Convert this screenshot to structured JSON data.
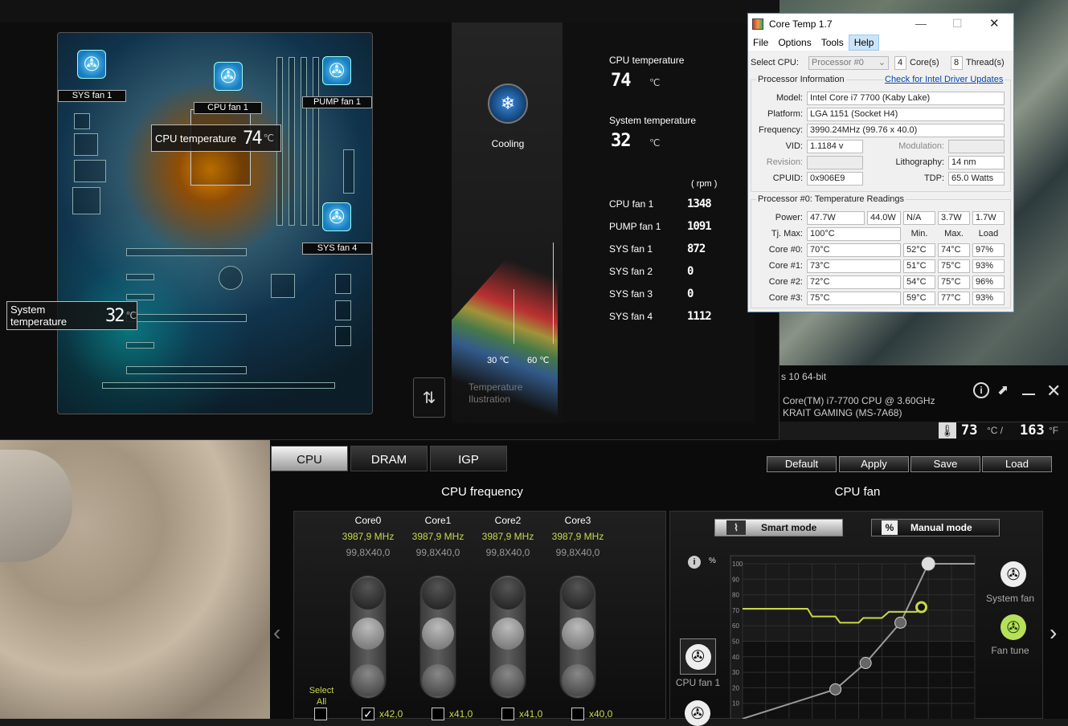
{
  "hw_monitor": {
    "fans": {
      "sys_fan_1": "SYS fan 1",
      "cpu_fan_1": "CPU fan 1",
      "pump_fan_1": "PUMP fan 1",
      "sys_fan_4": "SYS fan 4"
    },
    "cpu_temp_label": "CPU temperature",
    "cpu_temp_value": "74",
    "system_temp_label": "System temperature",
    "system_temp_value": "32",
    "unit_c": "℃",
    "cooling_label": "Cooling",
    "scale_low": "30 ℃",
    "scale_high": "60 ℃",
    "illustration_label_1": "Temperature",
    "illustration_label_2": "Ilustration",
    "readings": {
      "cpu_temperature_label": "CPU temperature",
      "cpu_temperature_value": "74",
      "system_temperature_label": "System temperature",
      "system_temperature_value": "32",
      "rpm_header": "( rpm )",
      "fans": [
        {
          "name": "CPU fan 1",
          "rpm": "1348"
        },
        {
          "name": "PUMP fan 1",
          "rpm": "1091"
        },
        {
          "name": "SYS fan 1",
          "rpm": "872"
        },
        {
          "name": "SYS fan 2",
          "rpm": "0"
        },
        {
          "name": "SYS fan 3",
          "rpm": "0"
        },
        {
          "name": "SYS fan 4",
          "rpm": "1112"
        }
      ]
    }
  },
  "core_temp": {
    "title": "Core Temp 1.7",
    "menu": [
      "File",
      "Options",
      "Tools",
      "Help"
    ],
    "select_cpu_label": "Select CPU:",
    "select_cpu_value": "Processor #0",
    "cores_count": "4",
    "cores_label": "Core(s)",
    "threads_count": "8",
    "threads_label": "Thread(s)",
    "processor_info_title": "Processor Information",
    "driver_link": "Check for Intel Driver Updates",
    "model_label": "Model:",
    "model_value": "Intel Core i7 7700 (Kaby Lake)",
    "platform_label": "Platform:",
    "platform_value": "LGA 1151 (Socket H4)",
    "frequency_label": "Frequency:",
    "frequency_value": "3990.24MHz (99.76 x 40.0)",
    "vid_label": "VID:",
    "vid_value": "1.1184 v",
    "modulation_label": "Modulation:",
    "revision_label": "Revision:",
    "lithography_label": "Lithography:",
    "lithography_value": "14 nm",
    "cpuid_label": "CPUID:",
    "cpuid_value": "0x906E9",
    "tdp_label": "TDP:",
    "tdp_value": "65.0 Watts",
    "temps_title": "Processor #0: Temperature Readings",
    "power_label": "Power:",
    "power_values": [
      "47.7W",
      "44.0W",
      "N/A",
      "3.7W",
      "1.7W"
    ],
    "tjmax_label": "Tj. Max:",
    "tjmax_value": "100°C",
    "col_min": "Min.",
    "col_max": "Max.",
    "col_load": "Load",
    "cores": [
      {
        "label": "Core #0:",
        "temp": "70°C",
        "min": "52°C",
        "max": "74°C",
        "load": "97%"
      },
      {
        "label": "Core #1:",
        "temp": "73°C",
        "min": "51°C",
        "max": "75°C",
        "load": "93%"
      },
      {
        "label": "Core #2:",
        "temp": "72°C",
        "min": "54°C",
        "max": "75°C",
        "load": "96%"
      },
      {
        "label": "Core #3:",
        "temp": "75°C",
        "min": "59°C",
        "max": "77°C",
        "load": "93%"
      }
    ]
  },
  "info_bar": {
    "os_partial": "s 10 64-bit",
    "cpu_name": "Core(TM) i7-7700 CPU @ 3.60GHz",
    "board_name": "KRAIT GAMING (MS-7A68)",
    "temp_c": "73",
    "unit_c": "°C /",
    "temp_f": "163",
    "unit_f": "°F"
  },
  "tabs": [
    "CPU",
    "DRAM",
    "IGP"
  ],
  "actions": {
    "default": "Default",
    "apply": "Apply",
    "save": "Save",
    "load": "Load"
  },
  "cpu_frequency": {
    "title": "CPU frequency",
    "cores": [
      {
        "name": "Core0",
        "freq": "3987,9 MHz",
        "ratio": "99,8X40,0",
        "mult": "x42,0",
        "checked": true
      },
      {
        "name": "Core1",
        "freq": "3987,9 MHz",
        "ratio": "99,8X40,0",
        "mult": "x41,0",
        "checked": false
      },
      {
        "name": "Core2",
        "freq": "3987,9 MHz",
        "ratio": "99,8X40,0",
        "mult": "x41,0",
        "checked": false
      },
      {
        "name": "Core3",
        "freq": "3987,9 MHz",
        "ratio": "99,8X40,0",
        "mult": "x40,0",
        "checked": false
      }
    ],
    "select_all_1": "Select",
    "select_all_2": "All"
  },
  "cpu_fan": {
    "title": "CPU fan",
    "smart_mode": "Smart mode",
    "manual_mode": "Manual mode",
    "percent": "%",
    "system_fan": "System fan",
    "fan_tune": "Fan tune",
    "cpu_fan_1": "CPU fan 1",
    "y_ticks": [
      "100",
      "90",
      "80",
      "70",
      "60",
      "50",
      "40",
      "30",
      "20",
      "10"
    ],
    "accent_color": "#c9d94a"
  },
  "chart_data": {
    "type": "line",
    "ylim": [
      0,
      100
    ],
    "series": [
      {
        "values": [
          [
            0,
            0
          ],
          [
            40,
            19
          ],
          [
            53,
            36
          ],
          [
            68,
            62
          ],
          [
            80,
            100
          ],
          [
            100,
            100
          ]
        ]
      },
      {
        "values": [
          [
            0,
            71
          ],
          [
            28,
            71
          ],
          [
            30,
            66
          ],
          [
            40,
            66
          ],
          [
            42,
            62
          ],
          [
            50,
            62
          ],
          [
            52,
            65
          ],
          [
            60,
            65
          ],
          [
            63,
            69
          ],
          [
            75,
            69
          ],
          [
            77,
            72
          ]
        ]
      }
    ]
  }
}
